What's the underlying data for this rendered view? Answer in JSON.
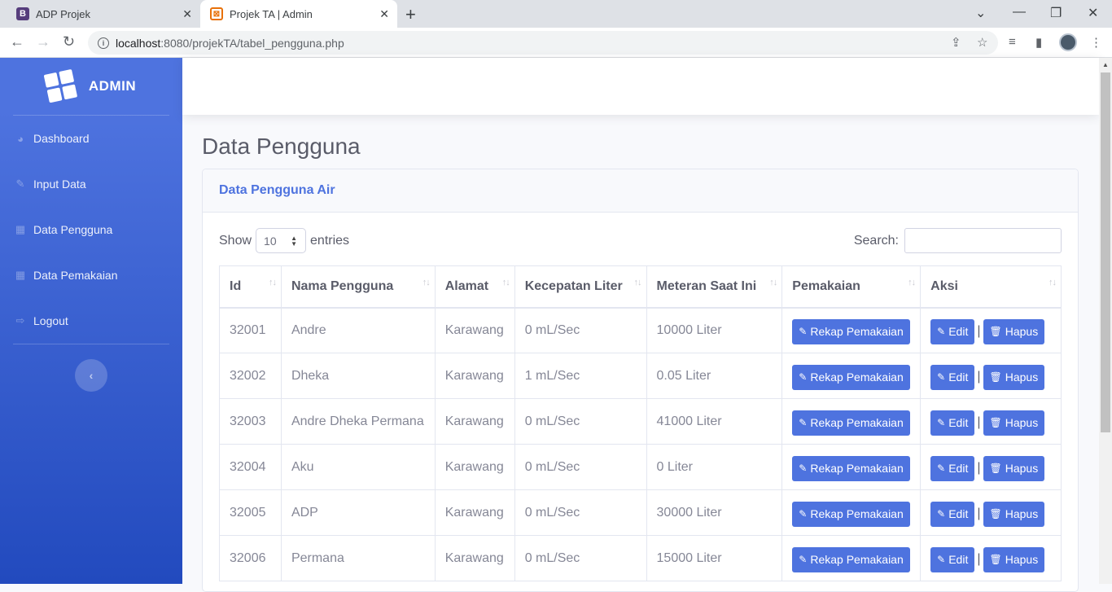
{
  "browser": {
    "tabs": [
      {
        "title": "ADP Projek",
        "favicon": "B"
      },
      {
        "title": "Projek TA | Admin",
        "favicon": "X"
      }
    ],
    "url_host": "localhost",
    "url_rest": ":8080/projekTA/tabel_pengguna.php"
  },
  "sidebar": {
    "brand": "ADMIN",
    "items": [
      {
        "label": "Dashboard",
        "icon": "tachometer-icon"
      },
      {
        "label": "Input Data",
        "icon": "edit-icon"
      },
      {
        "label": "Data Pengguna",
        "icon": "table-icon"
      },
      {
        "label": "Data Pemakaian",
        "icon": "table-icon"
      },
      {
        "label": "Logout",
        "icon": "sign-out-icon"
      }
    ]
  },
  "page": {
    "title": "Data Pengguna",
    "card_title": "Data Pengguna Air",
    "show_label": "Show",
    "entries_value": "10",
    "entries_label": "entries",
    "search_label": "Search:"
  },
  "table": {
    "headers": [
      "Id",
      "Nama Pengguna",
      "Alamat",
      "Kecepatan Liter",
      "Meteran Saat Ini",
      "Pemakaian",
      "Aksi"
    ],
    "rows": [
      {
        "id": "32001",
        "nama": "Andre",
        "alamat": "Karawang",
        "kecepatan": "0 mL/Sec",
        "meteran": "10000 Liter"
      },
      {
        "id": "32002",
        "nama": "Dheka",
        "alamat": "Karawang",
        "kecepatan": "1 mL/Sec",
        "meteran": "0.05 Liter"
      },
      {
        "id": "32003",
        "nama": "Andre Dheka Permana",
        "alamat": "Karawang",
        "kecepatan": "0 mL/Sec",
        "meteran": "41000 Liter"
      },
      {
        "id": "32004",
        "nama": "Aku",
        "alamat": "Karawang",
        "kecepatan": "0 mL/Sec",
        "meteran": "0 Liter"
      },
      {
        "id": "32005",
        "nama": "ADP",
        "alamat": "Karawang",
        "kecepatan": "0 mL/Sec",
        "meteran": "30000 Liter"
      },
      {
        "id": "32006",
        "nama": "Permana",
        "alamat": "Karawang",
        "kecepatan": "0 mL/Sec",
        "meteran": "15000 Liter"
      }
    ],
    "btn_rekap": "Rekap Pemakaian",
    "btn_edit": "Edit",
    "btn_hapus": "Hapus"
  }
}
